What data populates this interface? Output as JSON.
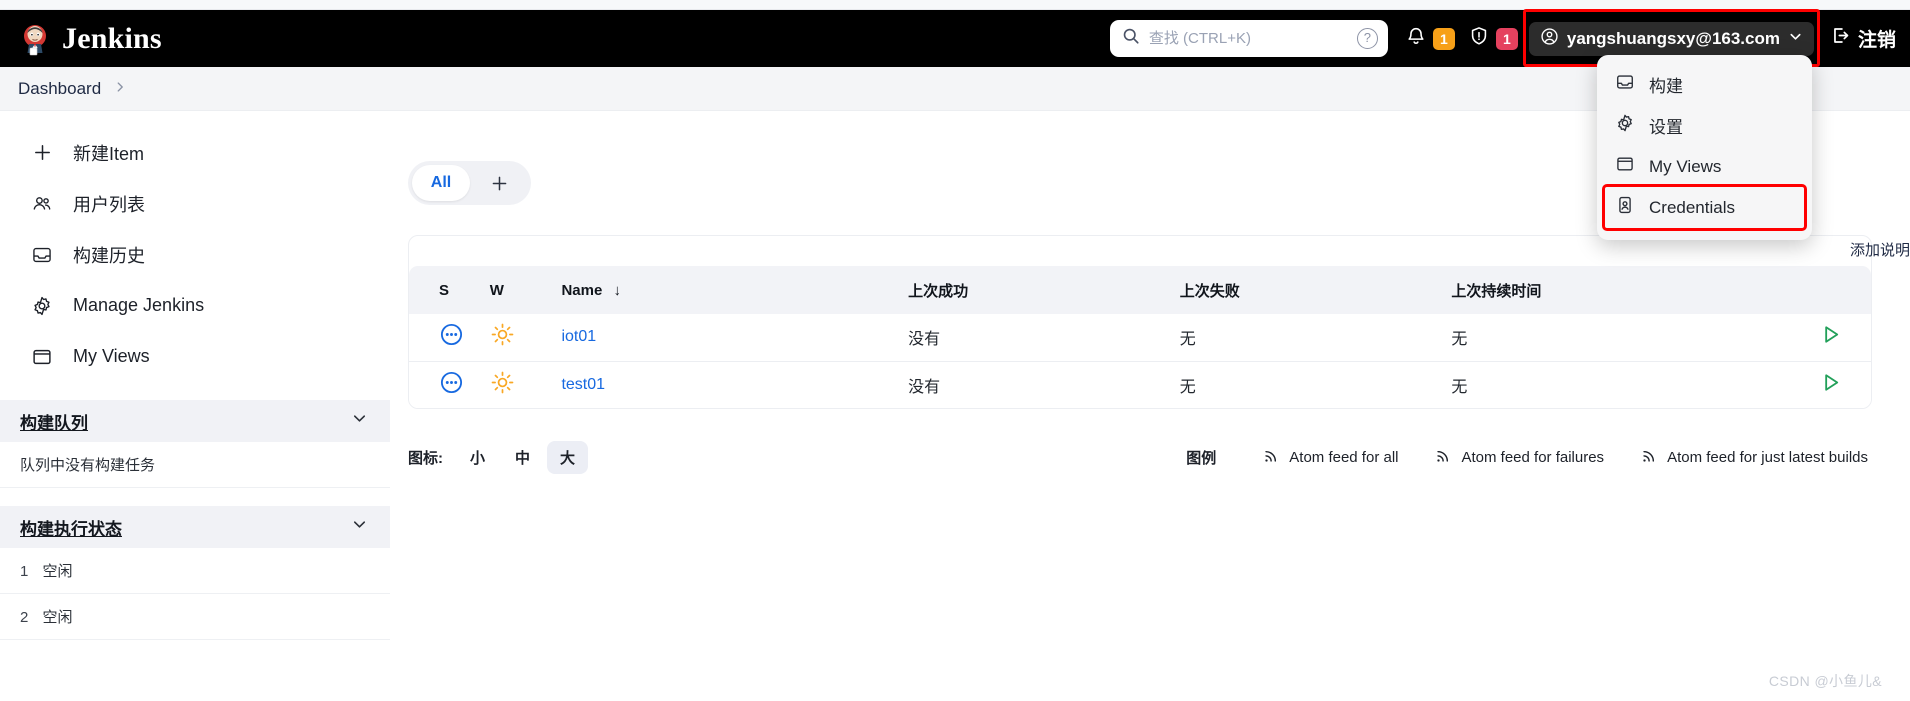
{
  "header": {
    "brand": "Jenkins",
    "logo_icon": "jenkins-butler-logo",
    "search": {
      "placeholder": "查找 (CTRL+K)",
      "value": "",
      "icon": "search-icon",
      "help_icon": "question-circle-icon"
    },
    "notifications": {
      "icon": "bell-icon",
      "count": "1",
      "color": "#f7a018"
    },
    "security": {
      "icon": "shield-warning-icon",
      "count": "1",
      "color": "#e5415e"
    },
    "user": {
      "label": "yangshuangsxy@163.com",
      "icon": "user-circle-icon",
      "chevron": "chevron-down-icon",
      "highlighted": true
    },
    "logout": {
      "label": "注销",
      "icon": "logout-icon"
    }
  },
  "user_menu": {
    "items": [
      {
        "label": "构建",
        "icon": "inbox-icon",
        "highlighted": false
      },
      {
        "label": "设置",
        "icon": "gear-icon",
        "highlighted": false
      },
      {
        "label": "My Views",
        "icon": "window-icon",
        "highlighted": false
      },
      {
        "label": "Credentials",
        "icon": "credential-card-icon",
        "highlighted": true
      }
    ]
  },
  "breadcrumb": {
    "items": [
      "Dashboard"
    ],
    "separator": "›"
  },
  "sidebar": {
    "nav": [
      {
        "label": "新建Item",
        "icon": "plus-icon"
      },
      {
        "label": "用户列表",
        "icon": "users-icon"
      },
      {
        "label": "构建历史",
        "icon": "inbox-icon"
      },
      {
        "label": "Manage Jenkins",
        "icon": "gear-icon"
      },
      {
        "label": "My Views",
        "icon": "window-icon"
      }
    ],
    "panels": [
      {
        "title": "构建队列",
        "chevron": "chevron-down-icon",
        "rows": [
          {
            "num": "",
            "text": "队列中没有构建任务"
          }
        ]
      },
      {
        "title": "构建执行状态",
        "chevron": "chevron-down-icon",
        "rows": [
          {
            "num": "1",
            "text": "空闲"
          },
          {
            "num": "2",
            "text": "空闲"
          }
        ]
      }
    ]
  },
  "main": {
    "view_tabs": [
      {
        "label": "All",
        "active": true
      },
      {
        "label": "+",
        "active": false,
        "is_add": true
      }
    ],
    "add_description": "添加说明",
    "table": {
      "columns": [
        {
          "key": "s",
          "label": "S"
        },
        {
          "key": "w",
          "label": "W"
        },
        {
          "key": "name",
          "label": "Name",
          "sort": "↓"
        },
        {
          "key": "last_success",
          "label": "上次成功"
        },
        {
          "key": "last_failure",
          "label": "上次失败"
        },
        {
          "key": "last_duration",
          "label": "上次持续时间"
        },
        {
          "key": "action",
          "label": ""
        }
      ],
      "rows": [
        {
          "status_icon": "pending-ellipsis-icon",
          "weather_icon": "sunny-icon",
          "name": "iot01",
          "last_success": "没有",
          "last_failure": "无",
          "last_duration": "无",
          "action_icon": "play-build-icon"
        },
        {
          "status_icon": "pending-ellipsis-icon",
          "weather_icon": "sunny-icon",
          "name": "test01",
          "last_success": "没有",
          "last_failure": "无",
          "last_duration": "无",
          "action_icon": "play-build-icon"
        }
      ]
    },
    "icon_size": {
      "label": "图标:",
      "options": [
        {
          "label": "小",
          "active": false
        },
        {
          "label": "中",
          "active": false
        },
        {
          "label": "大",
          "active": true
        }
      ]
    },
    "legend_label": "图例",
    "feeds": [
      {
        "label": "Atom feed for all",
        "icon": "rss-icon"
      },
      {
        "label": "Atom feed for failures",
        "icon": "rss-icon"
      },
      {
        "label": "Atom feed for just latest builds",
        "icon": "rss-icon"
      }
    ]
  },
  "watermark": "CSDN @小鱼儿&",
  "colors": {
    "accent_blue": "#1769e0",
    "header_black": "#000000",
    "badge_orange": "#f7a018",
    "badge_red": "#e5415e",
    "highlight_red": "#ff0000",
    "build_green": "#22a05a",
    "weather_orange": "#f9a825"
  }
}
